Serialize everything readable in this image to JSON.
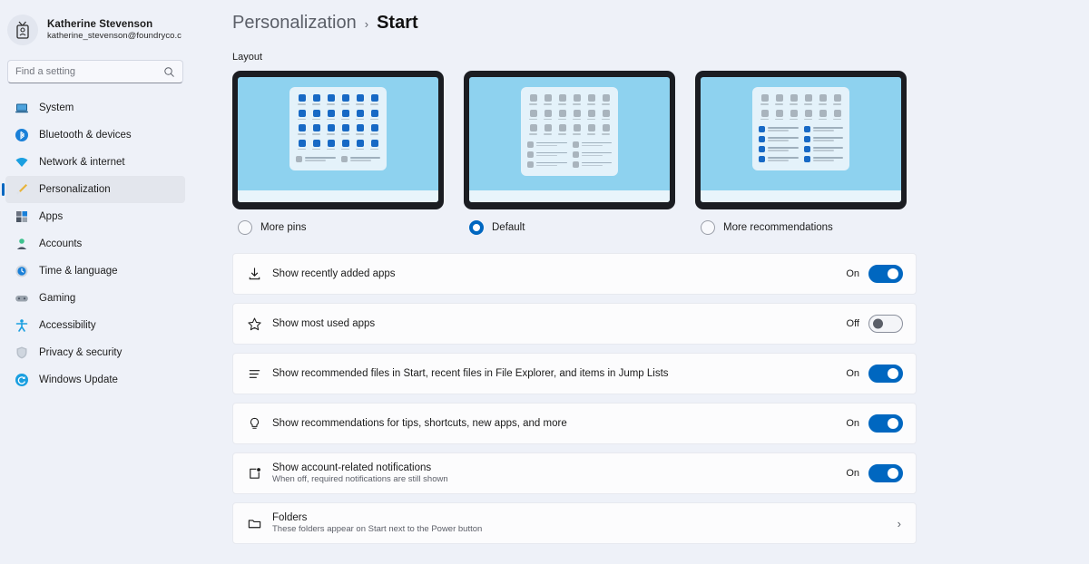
{
  "sidebar": {
    "profile": {
      "name": "Katherine Stevenson",
      "email": "katherine_stevenson@foundryco.com",
      "avatar_icon": "id-badge-icon"
    },
    "search": {
      "placeholder": "Find a setting",
      "value": "",
      "icon": "search-icon"
    },
    "items": [
      {
        "label": "System",
        "icon": "laptop-icon",
        "active": false
      },
      {
        "label": "Bluetooth & devices",
        "icon": "bluetooth-icon",
        "active": false
      },
      {
        "label": "Network & internet",
        "icon": "wifi-icon",
        "active": false
      },
      {
        "label": "Personalization",
        "icon": "paintbrush-icon",
        "active": true
      },
      {
        "label": "Apps",
        "icon": "apps-grid-icon",
        "active": false
      },
      {
        "label": "Accounts",
        "icon": "person-icon",
        "active": false
      },
      {
        "label": "Time & language",
        "icon": "clock-icon",
        "active": false
      },
      {
        "label": "Gaming",
        "icon": "gamepad-icon",
        "active": false
      },
      {
        "label": "Accessibility",
        "icon": "accessibility-icon",
        "active": false
      },
      {
        "label": "Privacy & security",
        "icon": "shield-icon",
        "active": false
      },
      {
        "label": "Windows Update",
        "icon": "refresh-icon",
        "active": false
      }
    ]
  },
  "header": {
    "breadcrumb_parent": "Personalization",
    "breadcrumb_separator": "›",
    "breadcrumb_current": "Start"
  },
  "layout_section": {
    "label": "Layout",
    "options": [
      {
        "label": "More pins",
        "selected": false,
        "pin_rows": 4,
        "pin_color": "blue",
        "rec_rows": 1,
        "rec_color": "gray"
      },
      {
        "label": "Default",
        "selected": true,
        "pin_rows": 3,
        "pin_color": "gray",
        "rec_rows": 3,
        "rec_color": "gray"
      },
      {
        "label": "More recommendations",
        "selected": false,
        "pin_rows": 2,
        "pin_color": "gray",
        "rec_rows": 4,
        "rec_color": "blue"
      }
    ]
  },
  "settings_rows": [
    {
      "icon": "download-icon",
      "title": "Show recently added apps",
      "sub": "",
      "control": "toggle",
      "state": "On",
      "on": true
    },
    {
      "icon": "star-icon",
      "title": "Show most used apps",
      "sub": "",
      "control": "toggle",
      "state": "Off",
      "on": false
    },
    {
      "icon": "list-icon",
      "title": "Show recommended files in Start, recent files in File Explorer, and items in Jump Lists",
      "sub": "",
      "control": "toggle",
      "state": "On",
      "on": true
    },
    {
      "icon": "lightbulb-icon",
      "title": "Show recommendations for tips, shortcuts, new apps, and more",
      "sub": "",
      "control": "toggle",
      "state": "On",
      "on": true
    },
    {
      "icon": "notification-icon",
      "title": "Show account-related notifications",
      "sub": "When off, required notifications are still shown",
      "control": "toggle",
      "state": "On",
      "on": true
    },
    {
      "icon": "folder-icon",
      "title": "Folders",
      "sub": "These folders appear on Start next to the Power button",
      "control": "chevron",
      "state": "",
      "on": false
    }
  ],
  "colors": {
    "accent": "#0067C0",
    "background": "#EEF1F8",
    "card": "#FCFCFD",
    "preview_screen": "#8ED2EF"
  }
}
